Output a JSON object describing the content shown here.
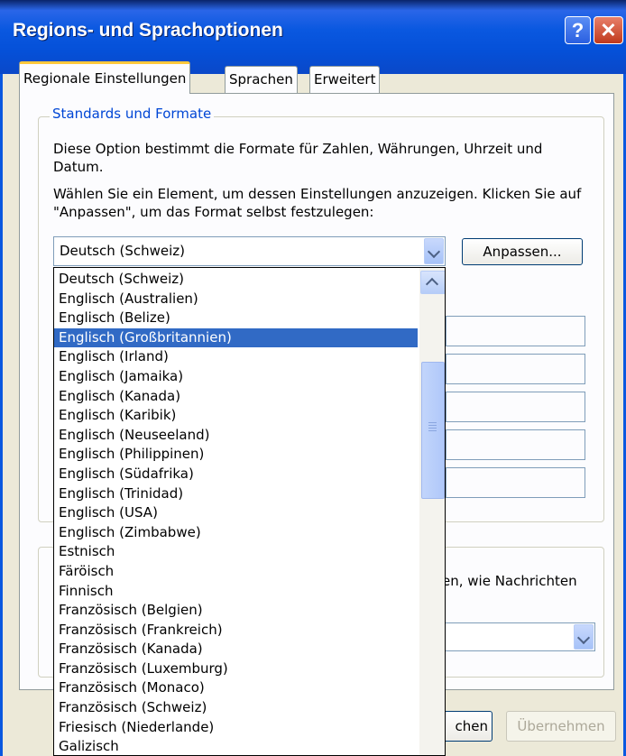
{
  "window": {
    "title": "Regions- und Sprachoptionen",
    "help_glyph": "?",
    "close_glyph": "✕"
  },
  "tabs": [
    {
      "label": "Regionale Einstellungen",
      "active": true
    },
    {
      "label": "Sprachen",
      "active": false
    },
    {
      "label": "Erweitert",
      "active": false
    }
  ],
  "formats": {
    "group_title": "Standards und Formate",
    "description1": "Diese Option bestimmt die Formate für Zahlen, Währungen, Uhrzeit und Datum.",
    "description2": "Wählen Sie ein Element, um dessen Einstellungen anzuzeigen. Klicken Sie auf \"Anpassen\", um das Format selbst festzulegen:",
    "selected_locale": "Deutsch (Schweiz)",
    "customize_label": "Anpassen..."
  },
  "dropdown": {
    "items": [
      "Deutsch (Schweiz)",
      "Englisch (Australien)",
      "Englisch (Belize)",
      "Englisch (Großbritannien)",
      "Englisch (Irland)",
      "Englisch (Jamaika)",
      "Englisch (Kanada)",
      "Englisch (Karibik)",
      "Englisch (Neuseeland)",
      "Englisch (Philippinen)",
      "Englisch (Südafrika)",
      "Englisch (Trinidad)",
      "Englisch (USA)",
      "Englisch (Zimbabwe)",
      "Estnisch",
      "Färöisch",
      "Finnisch",
      "Französisch (Belgien)",
      "Französisch (Frankreich)",
      "Französisch (Kanada)",
      "Französisch (Luxemburg)",
      "Französisch (Monaco)",
      "Französisch (Schweiz)",
      "Friesisch (Niederlande)",
      "Galizisch"
    ],
    "highlighted_index": 3
  },
  "location": {
    "partial_text": "en, wie Nachrichten"
  },
  "buttons": {
    "apply_partial": "chen",
    "uebernehmen": "Übernehmen"
  },
  "colors": {
    "titlebar": "#0a58e0",
    "selection": "#316ac5",
    "group_title": "#0046d5",
    "active_tab_accent": "#ffc83c"
  }
}
